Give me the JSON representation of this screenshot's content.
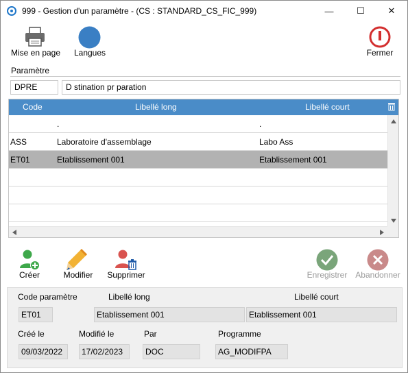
{
  "window": {
    "title": "999 - Gestion d'un paramètre - (CS : STANDARD_CS_FIC_999)",
    "minimize": "—",
    "maximize": "☐",
    "close": "✕"
  },
  "toolbar": {
    "print_label": "Mise en page",
    "languages_label": "Langues",
    "close_label": "Fermer"
  },
  "parameter": {
    "section_label": "Paramètre",
    "code": "DPRE",
    "description": "D stination pr paration"
  },
  "grid": {
    "columns": [
      "Code",
      "Libellé long",
      "Libellé court"
    ],
    "rows": [
      {
        "code": "",
        "long": ".",
        "short": "."
      },
      {
        "code": "ASS",
        "long": "Laboratoire d'assemblage",
        "short": "Labo Ass"
      },
      {
        "code": "ET01",
        "long": "Etablissement 001",
        "short": "Etablissement 001",
        "selected": true
      },
      {
        "code": "",
        "long": "",
        "short": ""
      },
      {
        "code": "",
        "long": "",
        "short": ""
      },
      {
        "code": "",
        "long": "",
        "short": ""
      }
    ]
  },
  "actions": {
    "create_label": "Créer",
    "modify_label": "Modifier",
    "delete_label": "Supprimer",
    "save_label": "Enregistrer",
    "abandon_label": "Abandonner"
  },
  "detail": {
    "code_label": "Code paramètre",
    "long_label": "Libellé long",
    "short_label": "Libellé court",
    "code_value": "ET01",
    "long_value": "Etablissement 001",
    "short_value": "Etablissement 001",
    "created_label": "Créé le",
    "modified_label": "Modifié le",
    "by_label": "Par",
    "program_label": "Programme",
    "created_value": "09/03/2022",
    "modified_value": "17/02/2023",
    "by_value": "DOC",
    "program_value": "AG_MODIFPA"
  },
  "colors": {
    "accent": "#4a8cc8",
    "selected_row": "#b2b2b2",
    "create_green": "#3ea84a",
    "delete_red": "#d9534f",
    "close_red": "#d32f2f",
    "languages_blue": "#3a7fc4",
    "disabled_green": "#7aa57a",
    "disabled_red": "#c98a8a"
  }
}
